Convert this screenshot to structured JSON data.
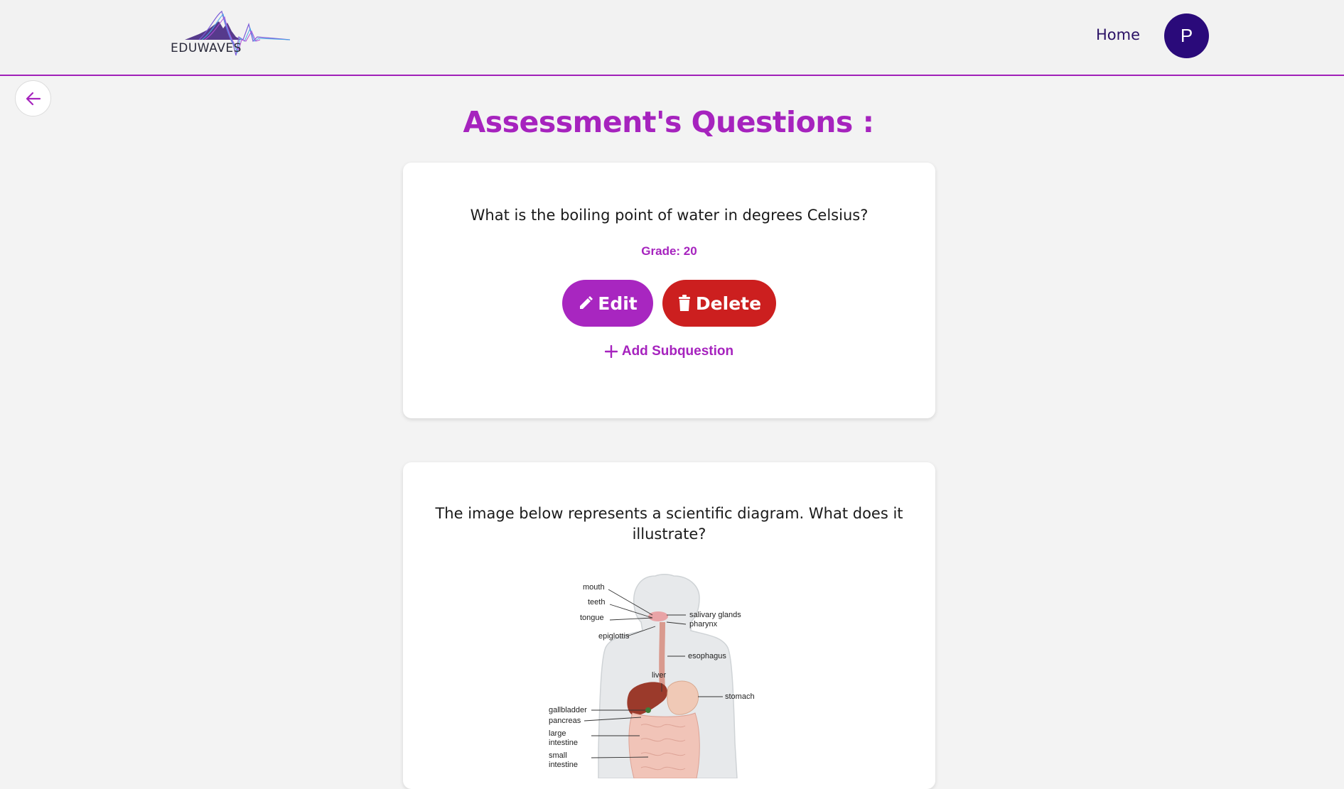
{
  "header": {
    "logo_text": "EDUWAVES",
    "home_label": "Home",
    "avatar_initial": "P"
  },
  "page": {
    "title": "Assessment's Questions :"
  },
  "questions": [
    {
      "text": "What is the boiling point of water in degrees Celsius?",
      "grade": "Grade: 20",
      "edit_label": "Edit",
      "delete_label": "Delete",
      "add_subquestion_label": "Add Subquestion"
    },
    {
      "text": "The image below represents a scientific diagram. What does it illustrate?",
      "diagram_labels": {
        "mouth": "mouth",
        "teeth": "teeth",
        "tongue": "tongue",
        "epiglottis": "epiglottis",
        "salivary": "salivary glands",
        "pharynx": "pharynx",
        "esophagus": "esophagus",
        "liver": "liver",
        "stomach": "stomach",
        "gallbladder": "gallbladder",
        "pancreas": "pancreas",
        "large1": "large",
        "large2": "intestine",
        "small1": "small",
        "small2": "intestine"
      }
    }
  ],
  "colors": {
    "accent": "#a623be",
    "danger": "#cc1f1f",
    "navy": "#2a0a7a"
  },
  "icons": {
    "back": "arrow-left-icon",
    "edit": "pencil-icon",
    "delete": "trash-icon",
    "add": "plus-icon"
  }
}
